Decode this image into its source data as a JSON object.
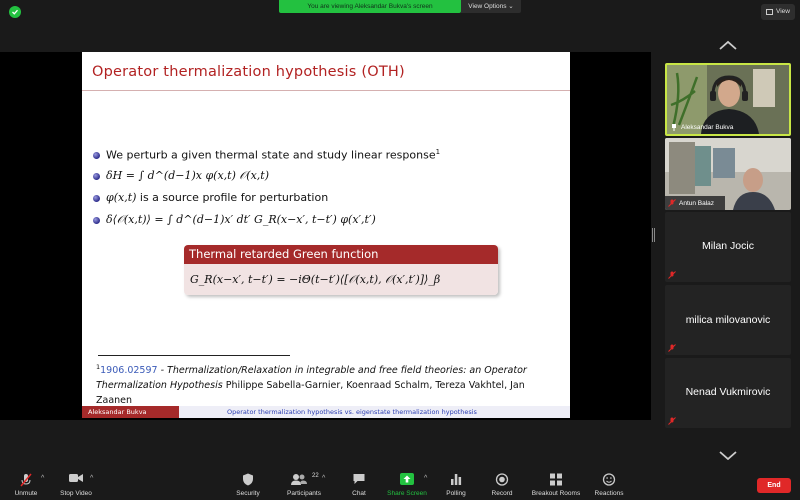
{
  "banner": {
    "viewing_text": "You are viewing Aleksandar Bukva's screen",
    "view_options_label": "View Options ⌄"
  },
  "view_button_label": "View",
  "slide": {
    "title": "Operator thermalization hypothesis (OTH)",
    "bullets": [
      {
        "text": "We perturb a given thermal state and study linear response",
        "sup": "1"
      },
      {
        "math": "δH = ∫ d^(d−1)x φ(x,t) 𝒪(x,t)"
      },
      {
        "math_lead": "φ(x,t)",
        "text": " is a source profile for perturbation"
      },
      {
        "math": "δ⟨𝒪(x,t)⟩ = ∫ d^(d−1)x′ dt′ G_R(x−x′, t−t′) φ(x′,t′)"
      }
    ],
    "box": {
      "title": "Thermal retarded Green function",
      "formula": "G_R(x−x′, t−t′) = −iΘ(t−t′)⟨[𝒪(x,t), 𝒪(x′,t′)]⟩_β"
    },
    "footnote": {
      "mark": "1",
      "link": "1906.02597",
      "italic": " - Thermalization/Relaxation in integrable and free field theories: an Operator Thermalization Hypothesis",
      "authors": " Philippe Sabella-Garnier, Koenraad Schalm, Tereza Vakhtel, Jan Zaanen"
    },
    "footer_author": "Aleksandar Bukva",
    "footer_title": "Operator thermalization hypothesis vs. eigenstate thermalization hypothesis"
  },
  "participants_panel": [
    {
      "name": "Aleksandar Bukva",
      "video": true
    },
    {
      "name": "Antun Balaz",
      "video": true
    },
    {
      "name": "Milan Jocic",
      "video": false
    },
    {
      "name": "milica milovanovic",
      "video": false
    },
    {
      "name": "Nenad Vukmirovic",
      "video": false
    }
  ],
  "toolbar": {
    "unmute": "Unmute",
    "stop_video": "Stop Video",
    "security": "Security",
    "participants": "Participants",
    "participants_count": "22",
    "chat": "Chat",
    "share_screen": "Share Screen",
    "polling": "Polling",
    "record": "Record",
    "breakout_rooms": "Breakout Rooms",
    "reactions": "Reactions",
    "end": "End"
  },
  "colors": {
    "banner_green": "#23c140",
    "slide_red": "#a52a2a",
    "end_red": "#e02828",
    "speaker_border": "#c8e645"
  }
}
